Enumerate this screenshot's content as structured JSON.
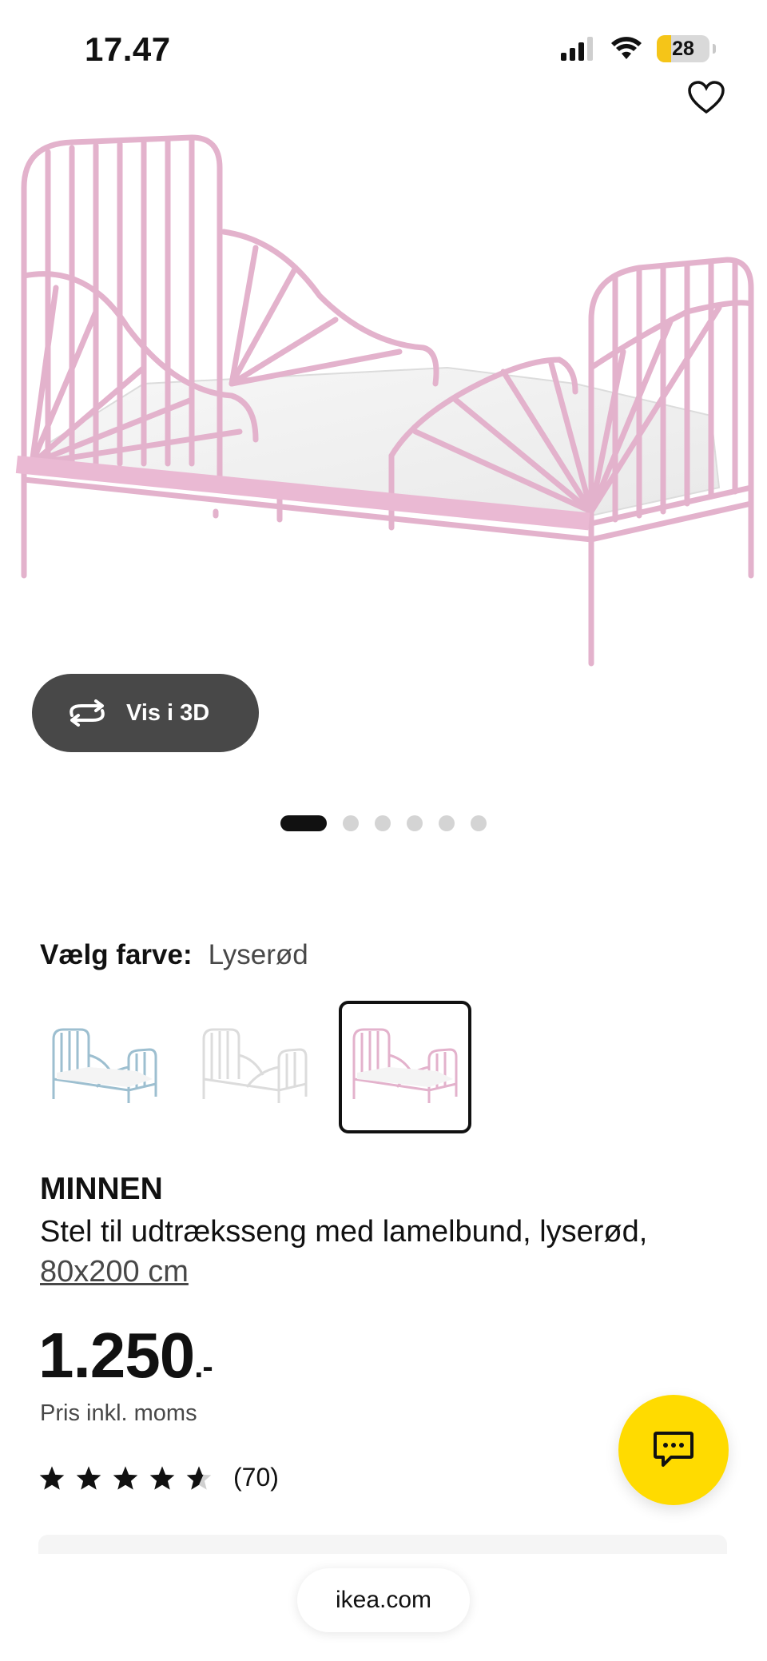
{
  "status": {
    "time": "17.47",
    "battery": "28",
    "battery_level": 0.28
  },
  "icons": {
    "favorite": "heart-icon",
    "rotate": "rotate-360-icon",
    "chat": "chat-bubble-icon",
    "signal": "signal-icon",
    "wifi": "wifi-icon"
  },
  "hero": {
    "image": "pink metal extendable bed frame with sunburst rails"
  },
  "view3d": {
    "label": "Vis i 3D"
  },
  "carousel": {
    "count": 6,
    "active": 0
  },
  "color": {
    "label": "Vælg farve:",
    "selected": "Lyserød",
    "options": [
      {
        "color": "#9dbfd0",
        "selected": false
      },
      {
        "color": "#e8e8e8",
        "selected": false
      },
      {
        "color": "#e8b7d0",
        "selected": true
      }
    ]
  },
  "product": {
    "name": "MINNEN",
    "description": "Stel til udtræksseng med lamelbund, lyserød,",
    "size": "80x200 cm",
    "price": "1.250",
    "price_suffix": ".-",
    "vat_note": "Pris inkl. moms",
    "rating": 4.5,
    "review_count": "(70)"
  },
  "browser": {
    "url": "ikea.com"
  },
  "colors": {
    "accent": "#ffdb00",
    "bed": "#e8b7d0",
    "button_bg": "#484848"
  }
}
